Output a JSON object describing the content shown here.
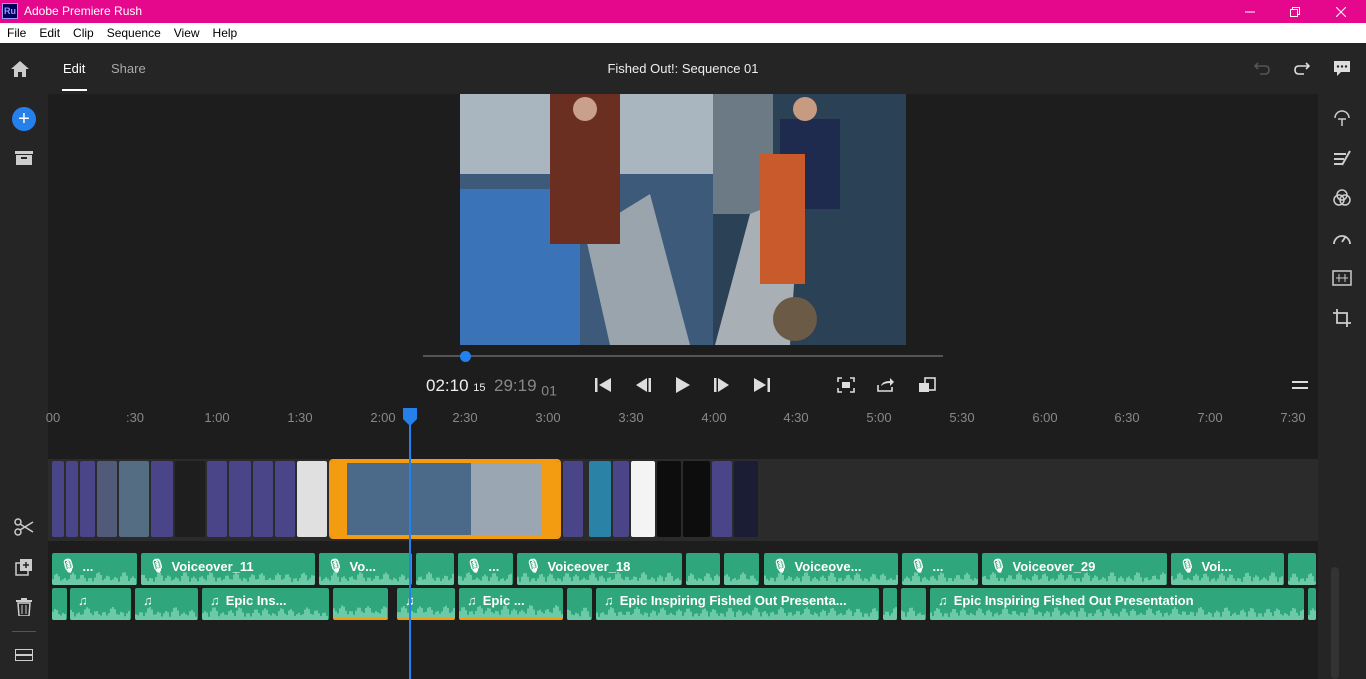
{
  "window": {
    "title": "Adobe Premiere Rush",
    "app_icon": "Ru"
  },
  "menu": [
    "File",
    "Edit",
    "Clip",
    "Sequence",
    "View",
    "Help"
  ],
  "header": {
    "tab_edit": "Edit",
    "tab_share": "Share",
    "sequence_title": "Fished Out!: Sequence 01"
  },
  "player": {
    "current": "02:10",
    "current_frames": "15",
    "duration": "29:19",
    "duration_frames": "01",
    "scrub_progress": 0.08
  },
  "ruler": [
    "00",
    ":30",
    "1:00",
    "1:30",
    "2:00",
    "2:30",
    "3:00",
    "3:30",
    "4:00",
    "4:30",
    "5:00",
    "5:30",
    "6:00",
    "6:30",
    "7:00",
    "7:30"
  ],
  "voice_clips": [
    "...",
    "Voiceover_11",
    "Vo...",
    "",
    "...",
    "Voiceover_18",
    "",
    "",
    "Voiceove...",
    "...",
    "Voiceover_29",
    "Voi...",
    ""
  ],
  "music_clips": [
    "",
    "",
    "Epic Ins...",
    "",
    "",
    "Epic ...",
    "",
    "Epic Inspiring Fished Out Presenta...",
    "",
    "Epic Inspiring Fished Out Presentation",
    ""
  ],
  "colors": {
    "brand": "#e6088c",
    "accent": "#2680eb",
    "video_clip": "#4a4488",
    "audio_clip": "#2fa67c",
    "selection": "#f39c12"
  }
}
